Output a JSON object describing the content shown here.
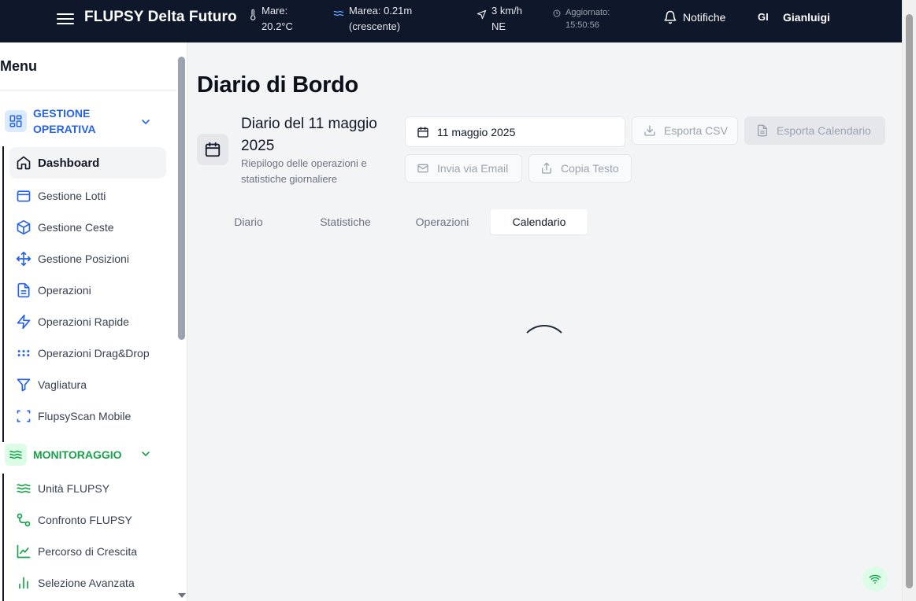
{
  "header": {
    "app_title": "FLUPSY Delta Futuro",
    "sea_label": "Mare:",
    "sea_value": "20.2°C",
    "tide_label": "Marea: 0.21m",
    "tide_state": "(crescente)",
    "wind_speed": "3 km/h",
    "wind_dir": "NE",
    "updated_label": "Aggiornato:",
    "updated_time": "15:50:56",
    "notifications_label": "Notifiche",
    "user_initials": "GI",
    "user_name": "Gianluigi"
  },
  "sidebar": {
    "menu_title": "Menu",
    "groups": [
      {
        "label": "GESTIONE OPERATIVA",
        "color": "#2563eb",
        "items": [
          {
            "label": "Dashboard",
            "icon": "home-icon",
            "active": true
          },
          {
            "label": "Gestione Lotti",
            "icon": "box-icon"
          },
          {
            "label": "Gestione Ceste",
            "icon": "package-icon"
          },
          {
            "label": "Gestione Posizioni",
            "icon": "move-icon"
          },
          {
            "label": "Operazioni",
            "icon": "document-icon"
          },
          {
            "label": "Operazioni Rapide",
            "icon": "zap-icon"
          },
          {
            "label": "Operazioni Drag&Drop",
            "icon": "grip-icon"
          },
          {
            "label": "Vagliatura",
            "icon": "filter-icon"
          },
          {
            "label": "FlupsyScan Mobile",
            "icon": "scan-icon"
          }
        ]
      },
      {
        "label": "MONITORAGGIO",
        "color": "#16a34a",
        "items": [
          {
            "label": "Unità FLUPSY",
            "icon": "waves-icon"
          },
          {
            "label": "Confronto FLUPSY",
            "icon": "git-compare-icon"
          },
          {
            "label": "Percorso di Crescita",
            "icon": "line-chart-icon"
          },
          {
            "label": "Selezione Avanzata",
            "icon": "bar-chart-icon"
          }
        ]
      }
    ]
  },
  "main": {
    "page_title": "Diario di Bordo",
    "diary_title": "Diario del 11 maggio 2025",
    "diary_subtitle": "Riepilogo delle operazioni e statistiche giornaliere",
    "date_value": "11 maggio 2025",
    "buttons": {
      "export_csv": "Esporta CSV",
      "export_calendar": "Esporta Calendario",
      "send_email": "Invia via Email",
      "copy_text": "Copia Testo"
    },
    "tabs": [
      {
        "label": "Diario",
        "active": false
      },
      {
        "label": "Statistiche",
        "active": false
      },
      {
        "label": "Operazioni",
        "active": false
      },
      {
        "label": "Calendario",
        "active": true
      }
    ]
  },
  "colors": {
    "header_bg": "#0f172a",
    "operativa_accent": "#2563eb",
    "monitoraggio_accent": "#16a34a"
  }
}
